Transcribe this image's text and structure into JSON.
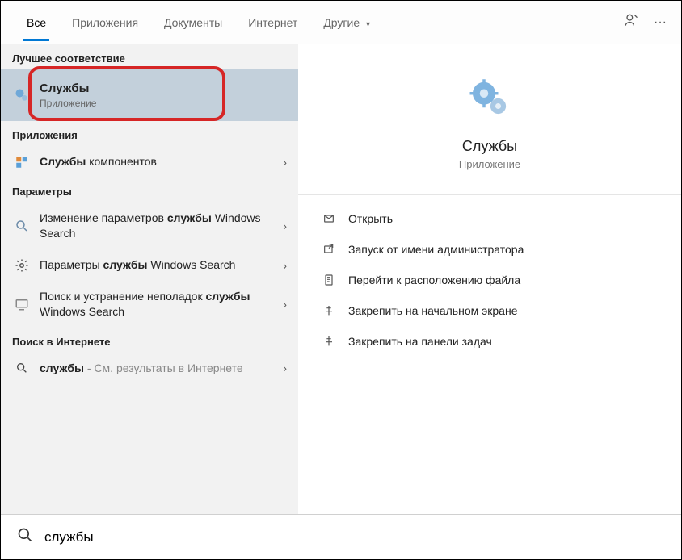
{
  "tabs": {
    "all": "Все",
    "apps": "Приложения",
    "docs": "Документы",
    "web": "Интернет",
    "other": "Другие"
  },
  "sections": {
    "best": "Лучшее соответствие",
    "apps": "Приложения",
    "settings": "Параметры",
    "web": "Поиск в Интернете"
  },
  "best_match": {
    "title": "Службы",
    "subtitle": "Приложение"
  },
  "app_results": {
    "r1_prefix": "Службы",
    "r1_suffix": " компонентов"
  },
  "settings_results": {
    "s1_pre": "Изменение параметров ",
    "s1_bold": "службы",
    "s1_post": " Windows Search",
    "s2_pre": "Параметры ",
    "s2_bold": "службы",
    "s2_post": " Windows Search",
    "s3_pre": "Поиск и устранение неполадок ",
    "s3_bold": "службы",
    "s3_post": " Windows Search"
  },
  "web_results": {
    "w1_bold": "службы",
    "w1_post": " - См. результаты в Интернете"
  },
  "preview": {
    "title": "Службы",
    "subtitle": "Приложение"
  },
  "actions": {
    "open": "Открыть",
    "admin": "Запуск от имени администратора",
    "location": "Перейти к расположению файла",
    "pin_start": "Закрепить на начальном экране",
    "pin_task": "Закрепить на панели задач"
  },
  "search": {
    "value": "службы"
  }
}
